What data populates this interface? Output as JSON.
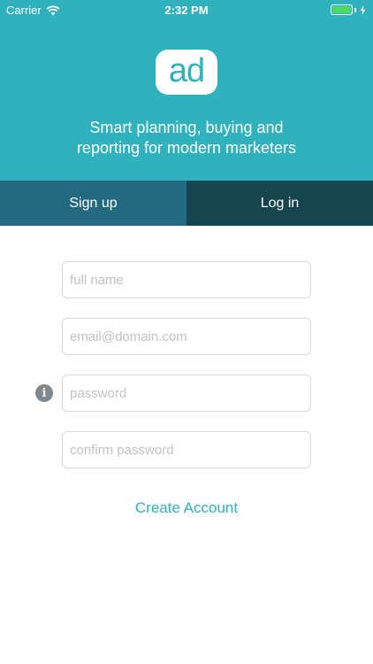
{
  "status_bar": {
    "carrier": "Carrier",
    "time": "2:32 PM"
  },
  "header": {
    "logo_text": "ad",
    "tagline_line1": "Smart planning, buying and",
    "tagline_line2": "reporting for modern marketers"
  },
  "tabs": {
    "signup": "Sign up",
    "login": "Log in"
  },
  "form": {
    "full_name_placeholder": "full name",
    "email_placeholder": "email@domain.com",
    "password_placeholder": "password",
    "confirm_password_placeholder": "confirm password",
    "create_account_label": "Create Account"
  },
  "colors": {
    "brand": "#2fb1be",
    "tab_active": "#236a80",
    "tab_inactive": "#15454f"
  }
}
